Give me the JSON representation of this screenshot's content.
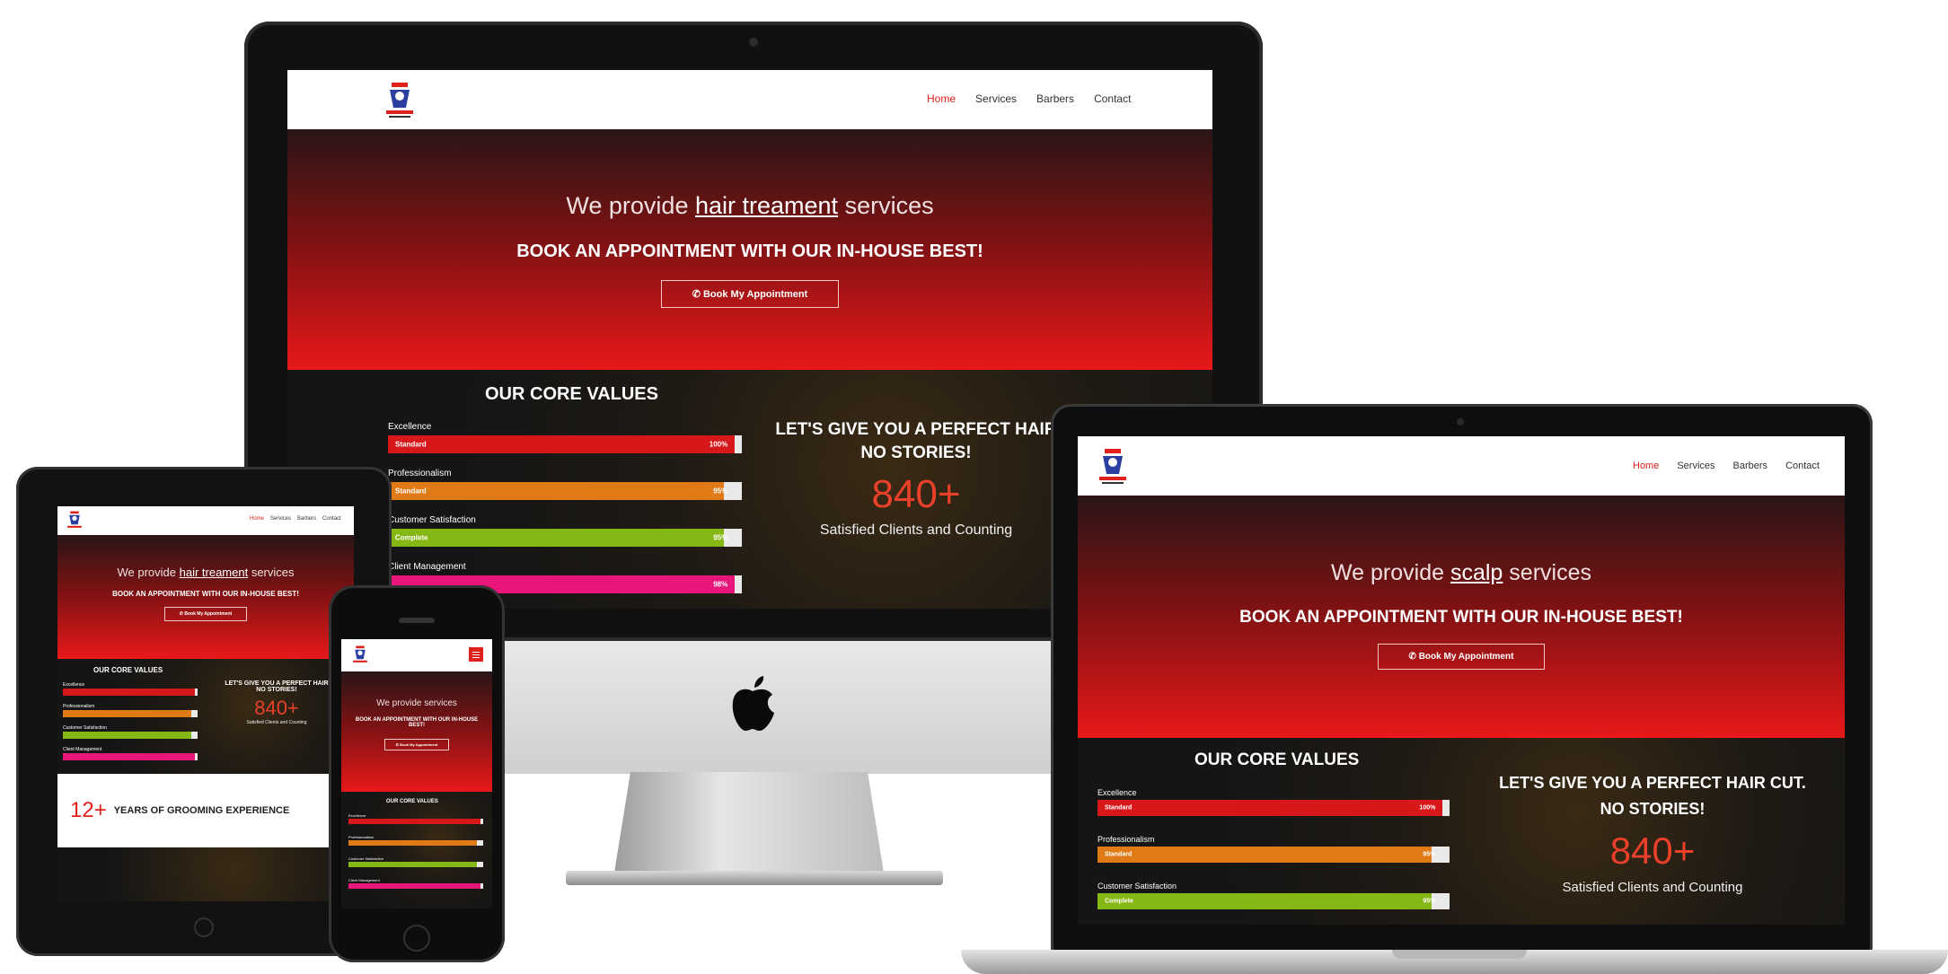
{
  "site": {
    "nav": {
      "items": [
        "Home",
        "Services",
        "Barbers",
        "Contact"
      ]
    },
    "hero": {
      "provide_prefix": "We provide",
      "provide_suffix": "services",
      "service_main": "hair treament",
      "service_laptop": "scalp",
      "book_headline": "BOOK AN APPOINTMENT WITH OUR IN-HOUSE BEST!",
      "book_button": "✆ Book My Appointment"
    },
    "values": {
      "title": "OUR CORE VALUES",
      "bars": [
        {
          "label": "Excellence",
          "inner": "Standard",
          "percent_label": "100%",
          "value": 1.0,
          "color": "#d7181b"
        },
        {
          "label": "Professionalism",
          "inner": "Standard",
          "percent_label": "95%",
          "value": 0.95,
          "color": "#e07a16"
        },
        {
          "label": "Customer Satisfaction",
          "inner": "Complete",
          "percent_label": "95%",
          "value": 0.95,
          "color": "#86b815"
        },
        {
          "label": "Client Management",
          "inner": "",
          "percent_label": "98%",
          "value": 0.98,
          "color": "#e8157a"
        }
      ],
      "slogan_line1_imac": "LET'S GIVE YOU A PERFECT HAIR",
      "slogan_line2_imac": "NO STORIES!",
      "slogan_line1_laptop": "LET'S GIVE YOU A PERFECT HAIR CUT.",
      "slogan_line2_laptop": "NO STORIES!",
      "count": "840+",
      "count_label": "Satisfied Clients and Counting"
    },
    "experience": {
      "years": "12+",
      "text": "YEARS OF GROOMING EXPERIENCE"
    }
  },
  "colors": {
    "accent_red": "#e0201a",
    "hero_top": "#2a1516",
    "hero_bottom": "#e8181a",
    "count_orange": "#e8402a"
  },
  "icons": [
    "apple-logo-icon",
    "barber-logo-icon",
    "phone-icon",
    "menu-icon"
  ]
}
